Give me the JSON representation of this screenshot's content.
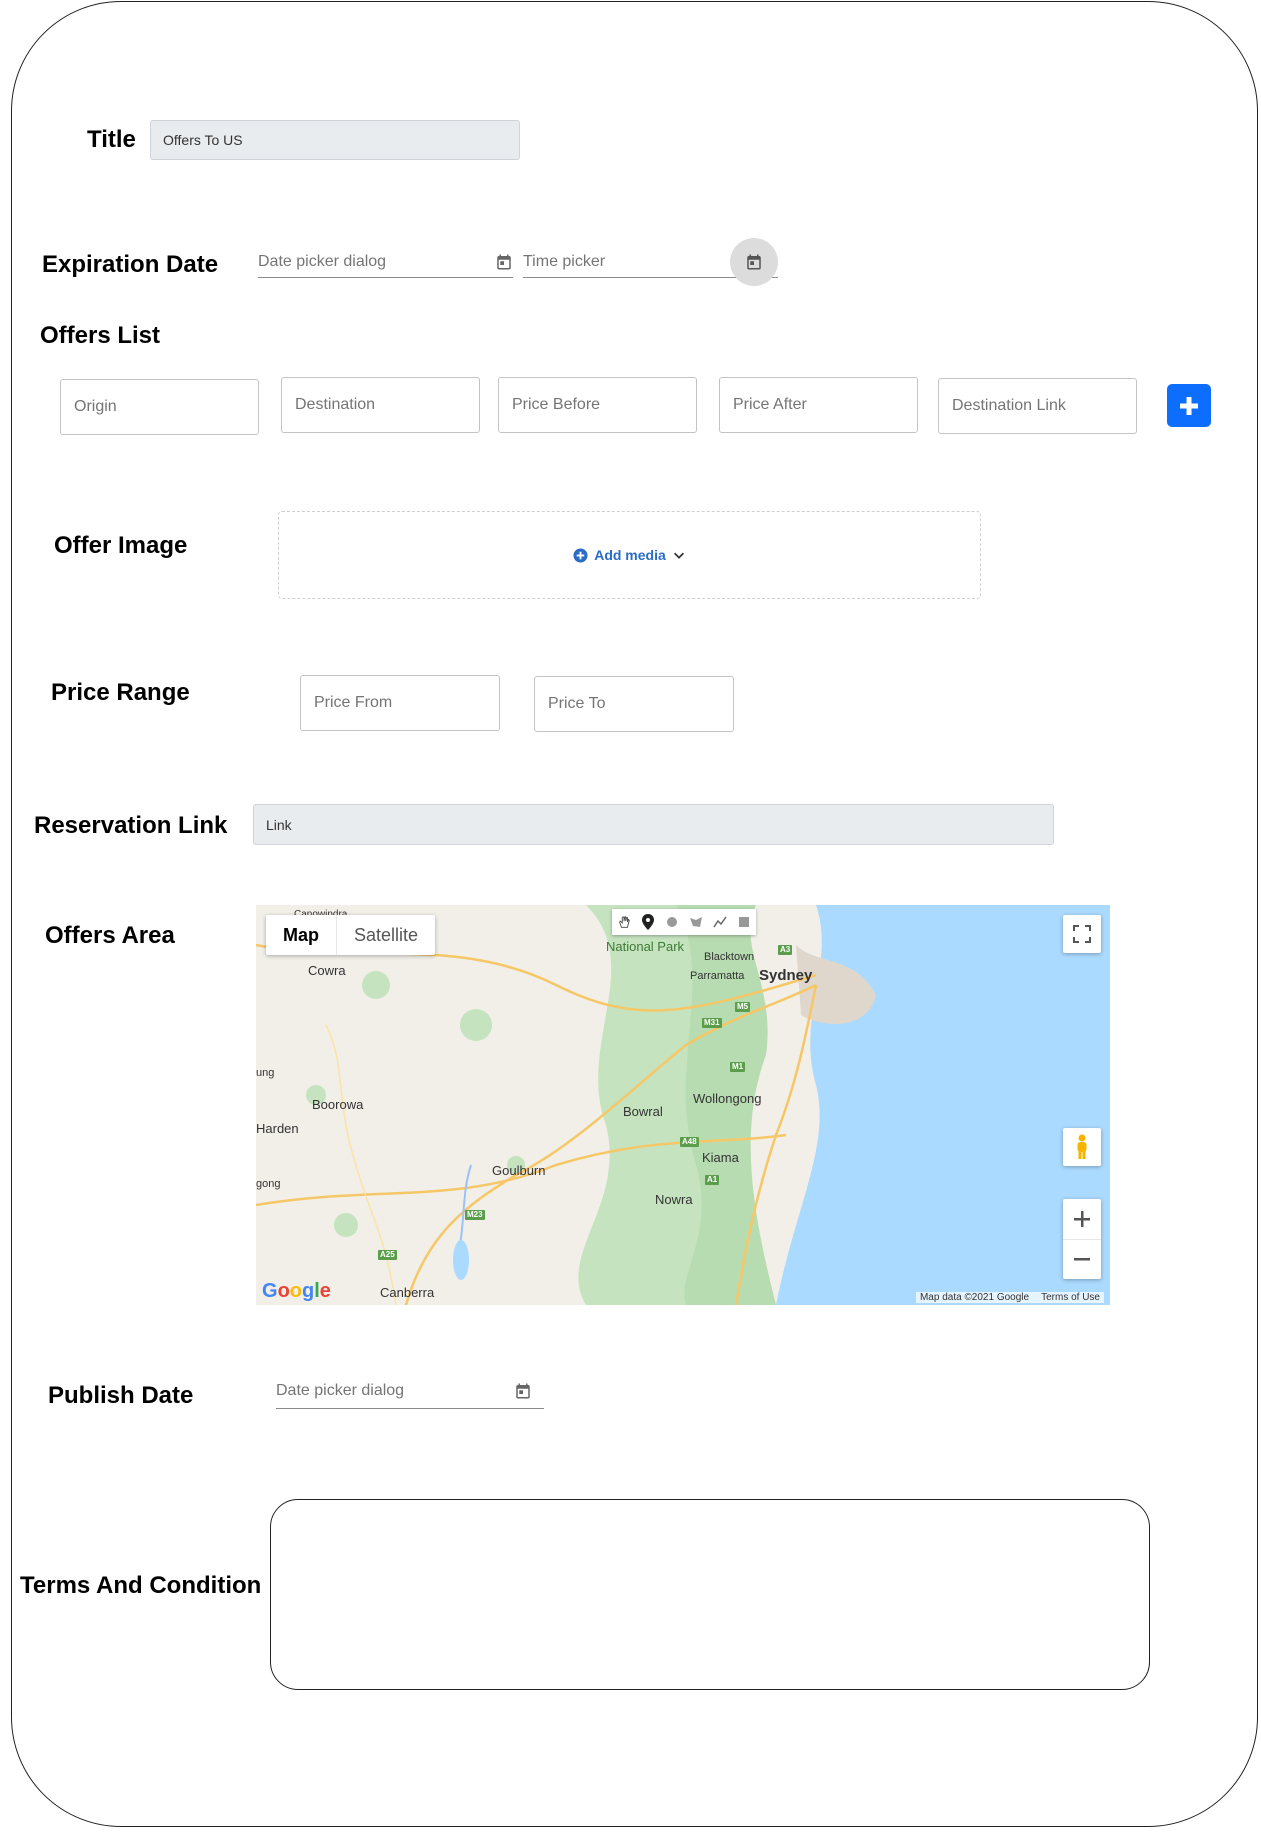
{
  "title": {
    "label": "Title",
    "value": "Offers To US"
  },
  "expiration": {
    "label": "Expiration Date",
    "date_placeholder": "Date picker dialog",
    "time_placeholder": "Time picker"
  },
  "offers_list": {
    "label": "Offers List",
    "fields": [
      "Origin",
      "Destination",
      "Price Before",
      "Price After",
      "Destination Link"
    ],
    "add_icon": "plus-icon"
  },
  "offer_image": {
    "label": "Offer Image",
    "add_media": "Add media"
  },
  "price_range": {
    "label": "Price Range",
    "from": "Price From",
    "to": "Price To"
  },
  "reservation": {
    "label": "Reservation Link",
    "placeholder": "Link"
  },
  "offers_area": {
    "label": "Offers Area",
    "map_type": {
      "map": "Map",
      "satellite": "Satellite",
      "selected": "Map"
    },
    "places": [
      "Canowindra",
      "Cowra",
      "Boorowa",
      "Harden",
      "Goulburn",
      "Canberra",
      "Bowral",
      "Wollongong",
      "Kiama",
      "Nowra",
      "Sydney",
      "Blacktown",
      "Parramatta",
      "National Park",
      "ung",
      "gong"
    ],
    "routes": [
      "M5",
      "M31",
      "M1",
      "A48",
      "A1",
      "M23",
      "A25",
      "A3"
    ],
    "attribution": [
      "Map data ©2021 Google",
      "Terms of Use"
    ],
    "logo": "Google"
  },
  "publish": {
    "label": "Publish Date",
    "date_placeholder": "Date picker dialog"
  },
  "terms": {
    "label": "Terms And Condition"
  },
  "colors": {
    "accent": "#0d6efd",
    "water": "#aadaff",
    "park": "#c5e3bf"
  }
}
